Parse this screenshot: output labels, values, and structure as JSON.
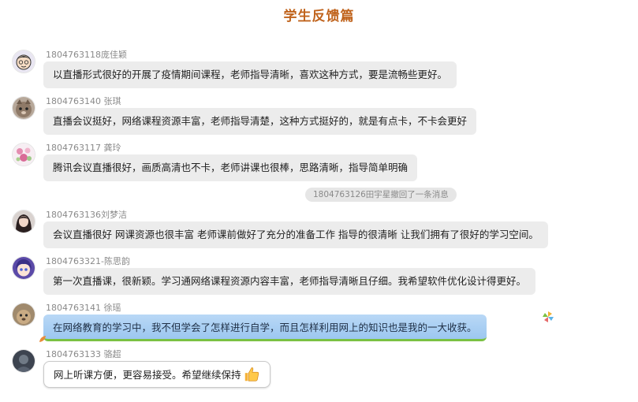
{
  "page": {
    "title": "学生反馈篇"
  },
  "messages": [
    {
      "sender": "1804763118庞佳颖",
      "text": "以直播形式很好的开展了疫情期间课程，老师指导清晰，喜欢这种方式，要是流畅些更好。",
      "avatar_icon": "cartoon-face-avatar"
    },
    {
      "sender": "1804763140  张琪",
      "text": "直播会议挺好，网络课程资源丰富，老师指导清楚，这种方式挺好的，就是有点卡，不卡会更好",
      "avatar_icon": "cat-photo-avatar"
    },
    {
      "sender": "1804763117 龚玲",
      "text": "腾讯会议直播很好，画质高清也不卡，老师讲课也很棒，思路清晰，指导简单明确",
      "avatar_icon": "flower-avatar"
    },
    {
      "sender": "1804763136刘梦洁",
      "text": "会议直播很好 网课资源也很丰富 老师课前做好了充分的准备工作 指导的很清晰 让我们拥有了很好的学习空间。",
      "avatar_icon": "girl-photo-avatar"
    },
    {
      "sender": "1804763321-陈思韵",
      "text": "第一次直播课，很新颖。学习通网络课程资源内容丰富，老师指导清晰且仔细。我希望软件优化设计得更好。",
      "avatar_icon": "anime-girl-avatar"
    },
    {
      "sender": "1804763141 徐瑶",
      "text": "在网络教育的学习中，我不但学会了怎样进行自学，而且怎样利用网上的知识也是我的一大收获。",
      "avatar_icon": "pet-photo-avatar"
    },
    {
      "sender": "1804763133 骆超",
      "text": "网上听课方便，更容易接受。希望继续保持",
      "avatar_icon": "dark-photo-avatar"
    }
  ],
  "recall_notice": "1804763126田宇星撤回了一条消息",
  "colors": {
    "title": "#c0631c",
    "bubble": "#ececec",
    "blue_bubble": "#9cc7f0",
    "green_trim": "#7bc143"
  }
}
